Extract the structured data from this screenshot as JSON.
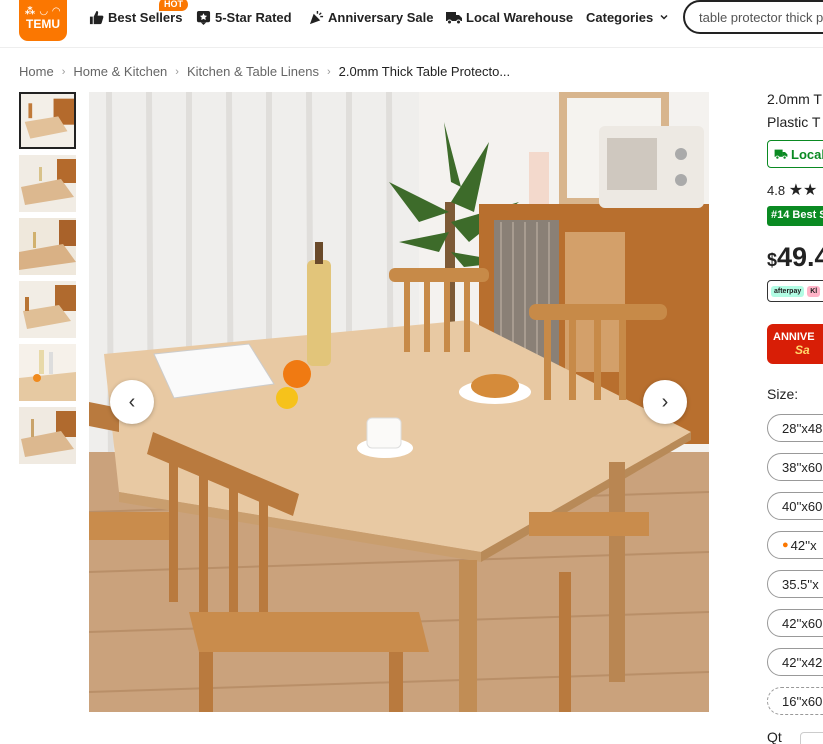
{
  "header": {
    "logo_symbols": "⁂ ◡ ◠",
    "logo_text": "TEMU",
    "nav": [
      {
        "label": "Best Sellers",
        "icon": "thumbs-up-icon"
      },
      {
        "label": "5-Star Rated",
        "icon": "star-badge-icon"
      },
      {
        "label": "Anniversary Sale",
        "icon": "party-popper-icon"
      },
      {
        "label": "Local Warehouse",
        "icon": "truck-icon"
      },
      {
        "label": "Categories",
        "icon": "chevron-down-icon"
      }
    ],
    "hot_badge": "HOT",
    "search_value": "table protector thick p"
  },
  "breadcrumb": [
    "Home",
    "Home & Kitchen",
    "Kitchen & Table Linens",
    "2.0mm Thick Table Protecto..."
  ],
  "gallery": {
    "prev_arrow": "‹",
    "next_arrow": "›",
    "thumbnail_count": 6
  },
  "product": {
    "title_line1": "2.0mm T",
    "title_line2": "Plastic T",
    "local_badge": "Local",
    "rating": "4.8",
    "best_badge": "#14 Best S",
    "currency": "$",
    "price": "49.4",
    "pay_afterpay": "afterpay",
    "pay_klarna": "Kl",
    "anniversary_line1": "ANNIVE",
    "anniversary_line2": "Sa",
    "size_label": "Size:",
    "sizes": [
      "28''x48",
      "38''x60",
      "40''x60",
      "42''x",
      "35.5''x",
      "42''x60",
      "42''x42",
      "16''x60"
    ],
    "qty_label": "Qt"
  },
  "colors": {
    "brand": "#fb7701",
    "green": "#0a8a22",
    "red": "#d81e06"
  }
}
